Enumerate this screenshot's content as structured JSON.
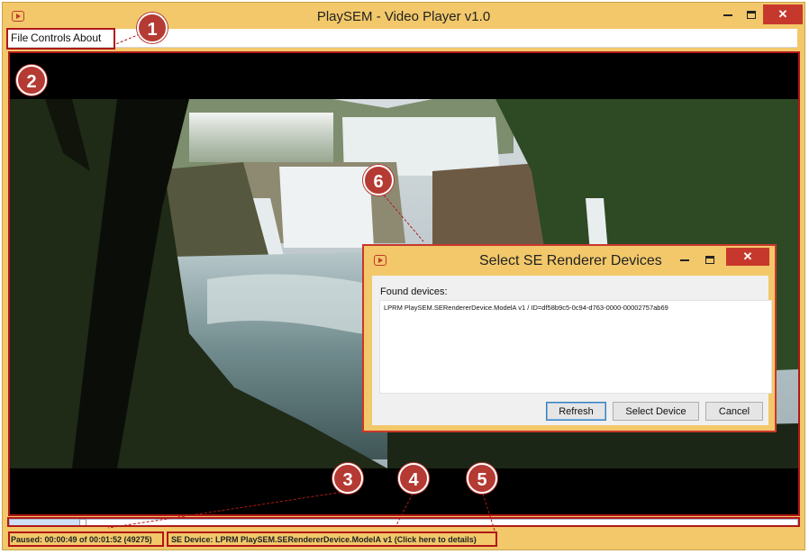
{
  "window": {
    "title": "PlaySEM - Video Player v1.0"
  },
  "menu": {
    "items": [
      "File",
      "Controls",
      "About"
    ]
  },
  "playback": {
    "progress_fraction": 0.44
  },
  "status": {
    "time": "Paused: 00:00:49 of 00:01:52 (49275)",
    "device": "SE Device: LPRM PlaySEM.SERendererDevice.ModelA v1 (Click here to details)"
  },
  "dialog": {
    "title": "Select SE Renderer Devices",
    "found_label": "Found devices:",
    "devices": [
      "LPRM PlaySEM.SERendererDevice.ModelA  v1 / ID=df58b9c5-0c94-d763-0000-00002757ab69"
    ],
    "buttons": {
      "refresh": "Refresh",
      "select": "Select Device",
      "cancel": "Cancel"
    }
  },
  "callouts": [
    "1",
    "2",
    "3",
    "4",
    "5",
    "6"
  ],
  "colors": {
    "accent": "#b43a33",
    "window_frame": "#f2c86a",
    "close": "#c7382c"
  },
  "icons": [
    "app-icon",
    "minimize-icon",
    "maximize-icon",
    "close-icon"
  ]
}
